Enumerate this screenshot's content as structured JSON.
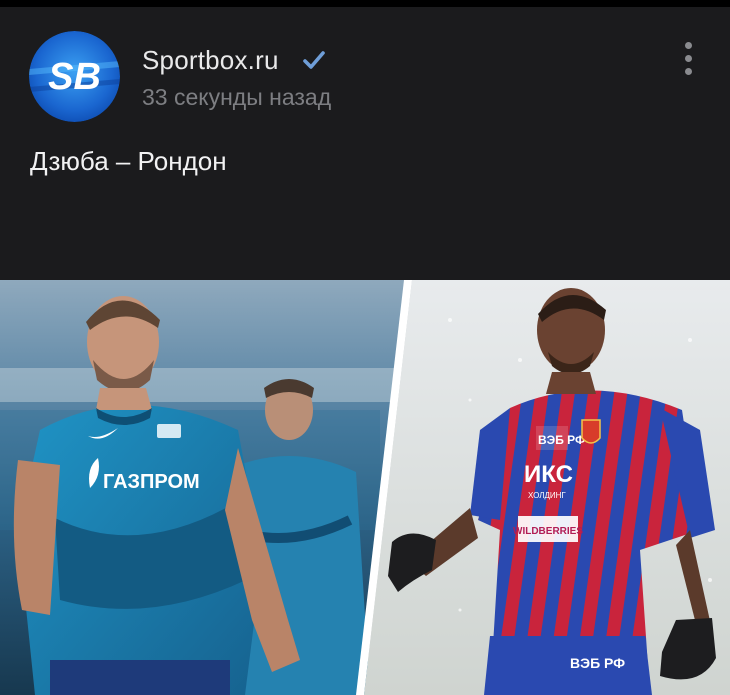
{
  "header": {
    "channel_name": "Sportbox.ru",
    "timestamp": "33 секунды назад",
    "avatar_text": "SB"
  },
  "post": {
    "text": "Дзюба – Рондон"
  },
  "left_jersey": {
    "sponsor": "ГАЗПРОМ"
  },
  "right_jersey": {
    "sponsor_top": "ВЭБ РФ",
    "sponsor_mid": "ИКС",
    "sponsor_sub": "ХОЛДИНГ",
    "sponsor_bottom": "WILDBERRIES",
    "shorts_text": "ВЭБ РФ"
  },
  "colors": {
    "background": "#1b1b1d",
    "verified": "#6f9ed8",
    "zenit_blue": "#1d86b8",
    "cska_red": "#c9243c",
    "cska_blue": "#2a49b0"
  },
  "icons": [
    "verified-icon",
    "more-vertical-icon"
  ]
}
